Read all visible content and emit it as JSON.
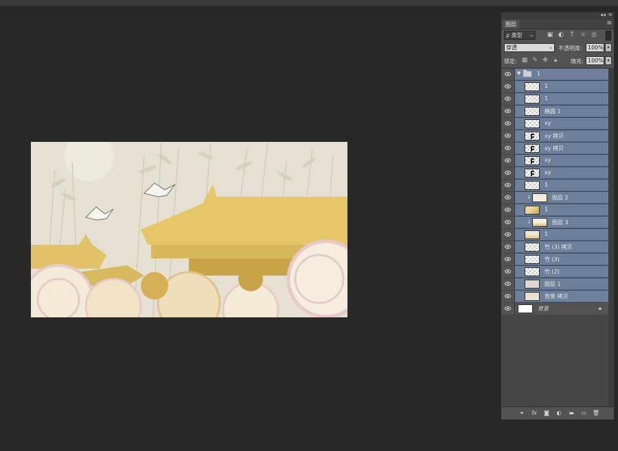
{
  "layers_panel": {
    "tab_label": "图层",
    "collapse_glyph": "◂◂",
    "close_glyph": "✕",
    "menu_glyph": "≡",
    "filter_kind": "ρ 类型",
    "blend_mode": "穿透",
    "opacity_label": "不透明度:",
    "opacity_value": "100%",
    "lock_label": "锁定:",
    "fill_label": "填充:",
    "fill_value": "100%",
    "layers": [
      {
        "name": "1",
        "type": "group",
        "selected": true
      },
      {
        "name": "1",
        "type": "layer",
        "selected": true
      },
      {
        "name": "1",
        "type": "layer",
        "selected": true
      },
      {
        "name": "椭圆 1",
        "type": "layer",
        "selected": true
      },
      {
        "name": "xy",
        "type": "layer",
        "selected": true
      },
      {
        "name": "xy 拷贝",
        "type": "layer",
        "selected": true
      },
      {
        "name": "xy 拷贝",
        "type": "layer",
        "selected": true
      },
      {
        "name": "xy",
        "type": "layer",
        "selected": true
      },
      {
        "name": "xy",
        "type": "layer",
        "selected": true
      },
      {
        "name": "1",
        "type": "layer",
        "selected": true
      },
      {
        "name": "图层 2",
        "type": "clipped",
        "selected": true
      },
      {
        "name": "1",
        "type": "layer",
        "selected": true
      },
      {
        "name": "图层 3",
        "type": "clipped",
        "selected": true
      },
      {
        "name": "1",
        "type": "layer",
        "selected": true
      },
      {
        "name": "竹 (3) 拷贝",
        "type": "layer",
        "selected": true
      },
      {
        "name": "竹 (3)",
        "type": "layer",
        "selected": true
      },
      {
        "name": "竹 (2)",
        "type": "layer",
        "selected": true
      },
      {
        "name": "图层 1",
        "type": "layer",
        "selected": true
      },
      {
        "name": "背景 拷贝",
        "type": "layer",
        "selected": true
      },
      {
        "name": "背景",
        "type": "background",
        "selected": false
      }
    ]
  },
  "canvas": {
    "palette": {
      "background": "#e6e0d3",
      "roof": "#e6c768",
      "roof_dark": "#c9a447",
      "cloud": "#f3ead8",
      "cloud_pink": "#e8c9c9",
      "bamboo": "#c9cbb5"
    }
  }
}
